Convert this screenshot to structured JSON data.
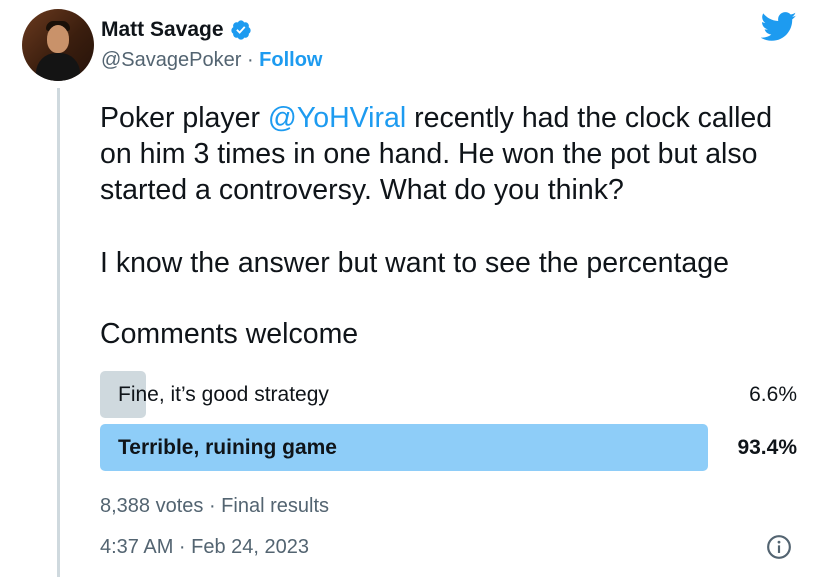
{
  "author": {
    "name": "Matt Savage",
    "handle": "@SavagePoker",
    "separator": " · ",
    "follow_label": "Follow"
  },
  "icons": {
    "verified": "verified-badge-icon",
    "brand": "twitter-bird-icon",
    "info": "info-icon"
  },
  "tweet": {
    "line1_pre": "Poker player ",
    "mention": "@YoHViral",
    "line1_post": " recently had the clock called on him 3 times in one hand. He won the pot but also started a controversy. What do you think?",
    "line2": "I know the answer but want to see the percentage",
    "line3": "Comments welcome"
  },
  "poll": {
    "options": [
      {
        "label": "Fine, it’s good strategy",
        "percent_label": "6.6%",
        "percent": 6.6,
        "winner": false
      },
      {
        "label": "Terrible, ruining game",
        "percent_label": "93.4%",
        "percent": 93.4,
        "winner": true
      }
    ],
    "votes_text": "8,388 votes · Final results"
  },
  "timestamp": "4:37 AM · Feb 24, 2023",
  "colors": {
    "accent": "#1d9bf0",
    "winner_bar": "#8ecdf8",
    "loser_bar": "#cfd9de",
    "muted_text": "#536471",
    "thread_line": "#cfd9de"
  }
}
